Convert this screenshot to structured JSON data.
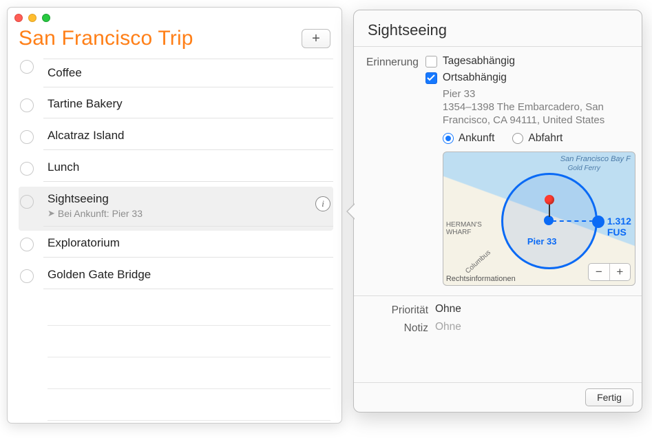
{
  "list": {
    "title": "San Francisco Trip",
    "add_label": "+",
    "items": [
      {
        "title": "Coffee"
      },
      {
        "title": "Tartine Bakery"
      },
      {
        "title": "Alcatraz Island"
      },
      {
        "title": "Lunch"
      },
      {
        "title": "Sightseeing",
        "sub_prefix": "Bei Ankunft:",
        "sub_value": "Pier 33",
        "selected": true
      },
      {
        "title": "Exploratorium"
      },
      {
        "title": "Golden Gate Bridge"
      }
    ]
  },
  "detail": {
    "title": "Sightseeing",
    "labels": {
      "reminder": "Erinnerung",
      "date_based": "Tagesabhängig",
      "location_based": "Ortsabhängig",
      "arrival": "Ankunft",
      "departure": "Abfahrt",
      "priority": "Priorität",
      "note": "Notiz",
      "done": "Fertig"
    },
    "location": {
      "name": "Pier 33",
      "address": "1354–1398 The Embarcadero, San Francisco, CA  94111, United States"
    },
    "map": {
      "distance_label": "1.312 FUS",
      "poi": "Pier 33",
      "legal": "Rechtsinformationen",
      "text_ferry": "San Francisco Bay F",
      "text_gold": "Gold Ferry",
      "text_herman": "HERMAN'S\nWHARF",
      "text_columbus": "Columbus"
    },
    "values": {
      "priority": "Ohne",
      "note": "Ohne"
    }
  }
}
